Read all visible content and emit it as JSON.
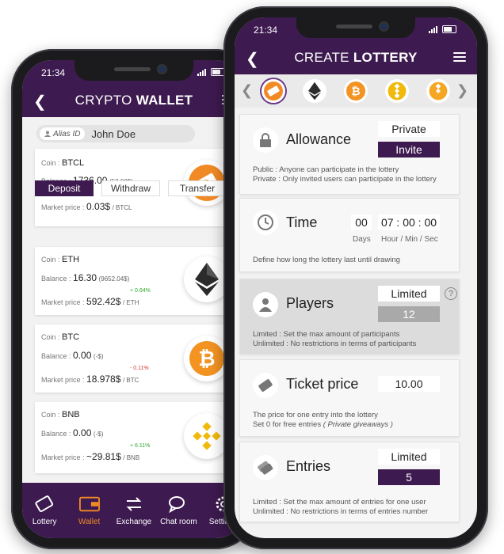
{
  "wallet": {
    "status_time": "21:34",
    "title_light": "CRYPTO",
    "title_bold": "WALLET",
    "alias_tag": "Alias ID",
    "alias_name": "John Doe",
    "labels": {
      "coin": "Coin :",
      "balance": "Balance :",
      "market_price": "Market price :"
    },
    "coins": [
      {
        "symbol": "BTCL",
        "balance": "1736.00",
        "balance_fiat": "(52.08$)",
        "price": "0.03$",
        "price_unit": "/ BTCL",
        "change": "",
        "icon": "ticket-coin-icon",
        "color": "#f08a24"
      },
      {
        "symbol": "ETH",
        "balance": "16.30",
        "balance_fiat": "(9652.04$)",
        "price": "592.42$",
        "price_unit": "/ ETH",
        "change": "+ 0.64%",
        "icon": "ethereum-icon",
        "color": "#2b2b2b"
      },
      {
        "symbol": "BTC",
        "balance": "0.00",
        "balance_fiat": "(-$)",
        "price": "18.978$",
        "price_unit": "/ BTC",
        "change": "- 0.11%",
        "icon": "bitcoin-icon",
        "color": "#f29322"
      },
      {
        "symbol": "BNB",
        "balance": "0.00",
        "balance_fiat": "(-$)",
        "price": "~29.81$",
        "price_unit": "/ BNB",
        "change": "+ 6.11%",
        "icon": "binance-icon",
        "color": "#f0b90b"
      }
    ],
    "actions": [
      "Deposit",
      "Withdraw",
      "Transfer"
    ],
    "tabs": [
      {
        "label": "Lottery",
        "icon": "ticket-icon"
      },
      {
        "label": "Wallet",
        "icon": "wallet-icon"
      },
      {
        "label": "Exchange",
        "icon": "exchange-icon"
      },
      {
        "label": "Chat room",
        "icon": "chat-icon"
      },
      {
        "label": "Settings",
        "icon": "gear-icon"
      }
    ],
    "active_tab": "Wallet",
    "colors": {
      "brand": "#3d1a4f",
      "accent": "#f08a24",
      "positive": "#2eaa2e",
      "negative": "#d23a3a"
    }
  },
  "lottery": {
    "status_time": "21:34",
    "title_light": "CREATE",
    "title_bold": "LOTTERY",
    "coin_icons": [
      "ticket-coin-icon",
      "ethereum-icon",
      "bitcoin-icon",
      "binance-icon",
      "binance-icon"
    ],
    "allowance": {
      "title": "Allowance",
      "options": [
        "Private",
        "Invite"
      ],
      "note1": "Public : Anyone can participate in the lottery",
      "note2": "Private : Only invited users can participate in the lottery"
    },
    "time": {
      "title": "Time",
      "days_value": "00",
      "hms_value": "07 : 00 : 00",
      "days_label": "Days",
      "hms_label": "Hour / Min / Sec",
      "note": "Define how long the lottery last until drawing"
    },
    "players": {
      "title": "Players",
      "mode": "Limited",
      "value": "12",
      "help": "?",
      "note1": "Limited : Set the max amount of participants",
      "note2": "Unlimited : No restrictions in terms of participants"
    },
    "ticket_price": {
      "title": "Ticket price",
      "value": "10.00",
      "note1": "The price for one entry into the lottery",
      "note2": "Set 0 for free entries",
      "note2_italic": "( Private giveaways )"
    },
    "entries": {
      "title": "Entries",
      "mode": "Limited",
      "value": "5",
      "note1": "Limited : Set the max amount of entries for one user",
      "note2": "Unlimited : No restrictions in terms of entries number"
    }
  }
}
